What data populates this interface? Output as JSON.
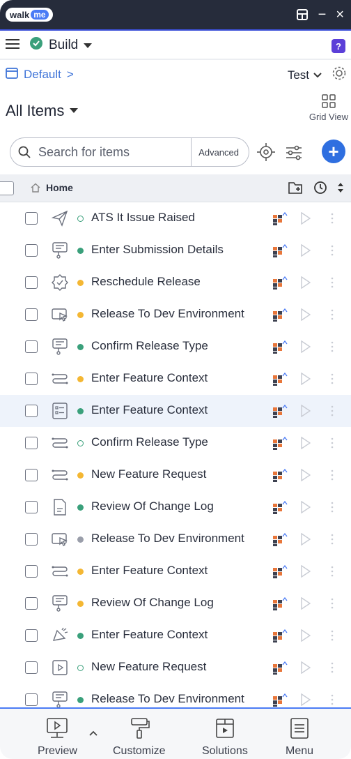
{
  "window": {
    "logo_text": "walk",
    "logo_badge": "me",
    "minimize": "−",
    "close": "×"
  },
  "build": {
    "label": "Build",
    "help": "?"
  },
  "env": {
    "crumb": "Default",
    "crumb_sep": ">",
    "env_label": "Test"
  },
  "items": {
    "title": "All Items",
    "grid_view": "Grid View"
  },
  "search": {
    "placeholder": "Search for items",
    "advanced": "Advanced",
    "add": "+"
  },
  "home": {
    "label": "Home"
  },
  "rows": [
    {
      "name": "ATS It Issue Raised",
      "icon": "send-icon",
      "status": "hollow"
    },
    {
      "name": "Enter Submission Details",
      "icon": "smart-tip-icon",
      "status": "green"
    },
    {
      "name": "Reschedule Release",
      "icon": "badge-check-icon",
      "status": "yellow"
    },
    {
      "name": "Release To Dev Environment",
      "icon": "launcher-icon",
      "status": "yellow"
    },
    {
      "name": "Confirm Release Type",
      "icon": "smart-tip-icon",
      "status": "green"
    },
    {
      "name": "Enter Feature Context",
      "icon": "flow-icon",
      "status": "yellow"
    },
    {
      "name": "Enter Feature Context",
      "icon": "form-icon",
      "status": "green"
    },
    {
      "name": "Confirm Release Type",
      "icon": "flow-icon",
      "status": "hollow"
    },
    {
      "name": "New Feature Request",
      "icon": "flow-icon",
      "status": "yellow"
    },
    {
      "name": "Review Of Change Log",
      "icon": "document-icon",
      "status": "green"
    },
    {
      "name": "Release To Dev Environment",
      "icon": "launcher-icon",
      "status": "gray"
    },
    {
      "name": "Enter Feature Context",
      "icon": "flow-icon",
      "status": "yellow"
    },
    {
      "name": "Review Of Change Log",
      "icon": "smart-tip-icon",
      "status": "yellow"
    },
    {
      "name": "Enter Feature Context",
      "icon": "announcement-icon",
      "status": "green"
    },
    {
      "name": "New Feature Request",
      "icon": "play-box-icon",
      "status": "hollow"
    },
    {
      "name": "Release To Dev Environment",
      "icon": "smart-tip-icon",
      "status": "green"
    }
  ],
  "bottom_tabs": {
    "preview": "Preview",
    "customize": "Customize",
    "solutions": "Solutions",
    "menu": "Menu"
  },
  "colors": {
    "titlebar": "#262c3b",
    "accent": "#2f6fe0",
    "green": "#3aa07b",
    "yellow": "#f4b733",
    "segment_orange": "#e8763a",
    "segment_dark": "#3d4150"
  }
}
